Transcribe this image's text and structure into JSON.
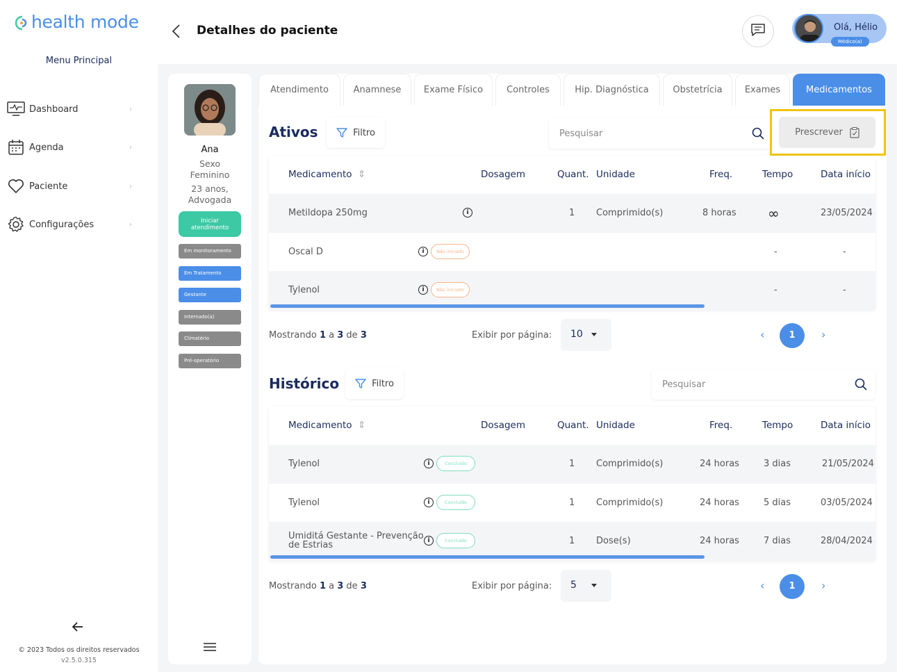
{
  "app": {
    "logo_text": "health mode",
    "brand_color": "#4a8ee8"
  },
  "sidebar": {
    "menu_title": "Menu Principal",
    "items": [
      {
        "label": "Dashboard",
        "icon": "monitor-icon"
      },
      {
        "label": "Agenda",
        "icon": "calendar-icon"
      },
      {
        "label": "Paciente",
        "icon": "heart-icon"
      },
      {
        "label": "Configurações",
        "icon": "gear-icon"
      }
    ],
    "copyright": "© 2023 Todos os direitos reservados",
    "version": "v2.5.0.315"
  },
  "header": {
    "title": "Detalhes do paciente",
    "user_greeting": "Olá, Hélio",
    "user_role": "Médico(a)"
  },
  "patient": {
    "name": "Ana",
    "sex_label": "Sexo",
    "sex": "Feminino",
    "age": "23 anos,",
    "occupation": "Advogada",
    "start_button": "Iniciar atendimento",
    "tags": [
      {
        "label": "Em monitoramento",
        "color": "#8a8a8a"
      },
      {
        "label": "Em Tratamento",
        "color": "#4a8ee8"
      },
      {
        "label": "Gestante",
        "color": "#4a8ee8"
      },
      {
        "label": "Internado(a)",
        "color": "#8a8a8a"
      },
      {
        "label": "Climatério",
        "color": "#8a8a8a"
      },
      {
        "label": "Pré-operatório",
        "color": "#8a8a8a"
      }
    ]
  },
  "tabs": [
    "Atendimento",
    "Anamnese",
    "Exame Físico",
    "Controles",
    "Hip. Diagnóstica",
    "Obstetrícia",
    "Exames",
    "Medicamentos"
  ],
  "active_tab": "Medicamentos",
  "columns": [
    "Medicamento",
    "Dosagem",
    "Quant.",
    "Unidade",
    "Freq.",
    "Tempo",
    "Data início"
  ],
  "ativos": {
    "title": "Ativos",
    "filter_label": "Filtro",
    "search_placeholder": "Pesquisar",
    "prescribe_label": "Prescrever",
    "rows": [
      {
        "medicamento": "Metildopa 250mg",
        "status": "",
        "quant": "1",
        "unidade": "Comprimido(s)",
        "freq": "8 horas",
        "tempo": "∞",
        "data": "23/05/2024"
      },
      {
        "medicamento": "Oscal D",
        "status": "Não iniciado",
        "quant": "",
        "unidade": "",
        "freq": "",
        "tempo": "-",
        "data": "-"
      },
      {
        "medicamento": "Tylenol",
        "status": "Não iniciado",
        "quant": "",
        "unidade": "",
        "freq": "",
        "tempo": "-",
        "data": "-"
      }
    ],
    "pager": {
      "showing": "Mostrando",
      "from": "1",
      "a": "a",
      "to": "3",
      "de": "de",
      "total": "3",
      "per_page_label": "Exibir por página:",
      "per_page": "10",
      "page": "1"
    }
  },
  "historico": {
    "title": "Histórico",
    "filter_label": "Filtro",
    "search_placeholder": "Pesquisar",
    "rows": [
      {
        "medicamento": "Tylenol",
        "status": "Concluído",
        "quant": "1",
        "unidade": "Comprimido(s)",
        "freq": "24 horas",
        "tempo": "3 dias",
        "data": "21/05/2024"
      },
      {
        "medicamento": "Tylenol",
        "status": "Concluído",
        "quant": "1",
        "unidade": "Comprimido(s)",
        "freq": "24 horas",
        "tempo": "5 dias",
        "data": "03/05/2024"
      },
      {
        "medicamento_line1": "Umiditá Gestante - Prevenção",
        "medicamento_line2": "de Estrias",
        "status": "Concluído",
        "quant": "1",
        "unidade": "Dose(s)",
        "freq": "24 horas",
        "tempo": "7 dias",
        "data": "28/04/2024"
      }
    ],
    "pager": {
      "showing": "Mostrando",
      "from": "1",
      "a": "a",
      "to": "3",
      "de": "de",
      "total": "3",
      "per_page_label": "Exibir por página:",
      "per_page": "5",
      "page": "1"
    }
  },
  "colors": {
    "accent": "#4a8ee8",
    "teal": "#3cc9a4",
    "highlight": "#f2c40c",
    "title_navy": "#1a2b5c"
  }
}
